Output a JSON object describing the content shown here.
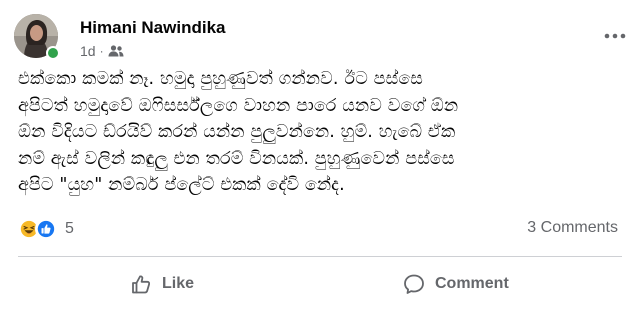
{
  "post": {
    "author_name": "Himani Nawindika",
    "timestamp": "1d",
    "separator": "·",
    "audience_icon": "friends-icon",
    "more_icon": "more-options-icon",
    "body_lines": [
      "එක්කො කමක් නෑ. හමුදා පුහුණුවත් ගන්නව. ඊට පස්සෙ",
      "අපිටත් හමුදාවේ ඔෆිසර්ස්ලගෙ වාහන පාරෙ යනව වගේ ඕන",
      "ඕන විදියට ඩ්රයිව් කරන් යන්න පුලුවන්නෙ. හුම්. හැබේ ඒක",
      "නම් ඇස් වලින් කඳුලු එන තරම් විනයක්. පුහුණුවෙන් පස්සෙ",
      "අපිට \"යුහ\" නම්බර් ප්ලේට් එකක් දේවි නේද."
    ]
  },
  "reactions": {
    "icons": [
      "haha-reaction-icon",
      "like-reaction-icon"
    ],
    "count": "5"
  },
  "comments": {
    "count_label": "3 Comments"
  },
  "actions": {
    "like_label": "Like",
    "comment_label": "Comment"
  },
  "colors": {
    "text_primary": "#050505",
    "text_secondary": "#65676b",
    "like_blue": "#1877f2",
    "haha_yellow": "#f7b928",
    "online_green": "#31a24c",
    "divider": "#ced0d4"
  }
}
